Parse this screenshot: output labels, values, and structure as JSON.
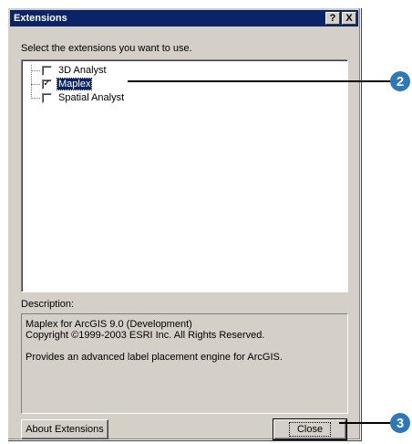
{
  "window": {
    "title": "Extensions",
    "help_glyph": "?",
    "close_glyph": "X"
  },
  "prompt": "Select the extensions you want to use.",
  "extensions": [
    {
      "label": "3D Analyst",
      "checked": false,
      "selected": false
    },
    {
      "label": "Maplex",
      "checked": true,
      "selected": true
    },
    {
      "label": "Spatial Analyst",
      "checked": false,
      "selected": false
    }
  ],
  "description": {
    "label": "Description:",
    "line1": "Maplex for ArcGIS 9.0 (Development)",
    "line2": "Copyright ©1999-2003 ESRI Inc. All Rights Reserved.",
    "line3": "Provides an advanced label placement engine for ArcGIS."
  },
  "buttons": {
    "about": "About Extensions",
    "close": "Close"
  },
  "callouts": {
    "c2": "2",
    "c3": "3",
    "color": "#2c78b8"
  }
}
